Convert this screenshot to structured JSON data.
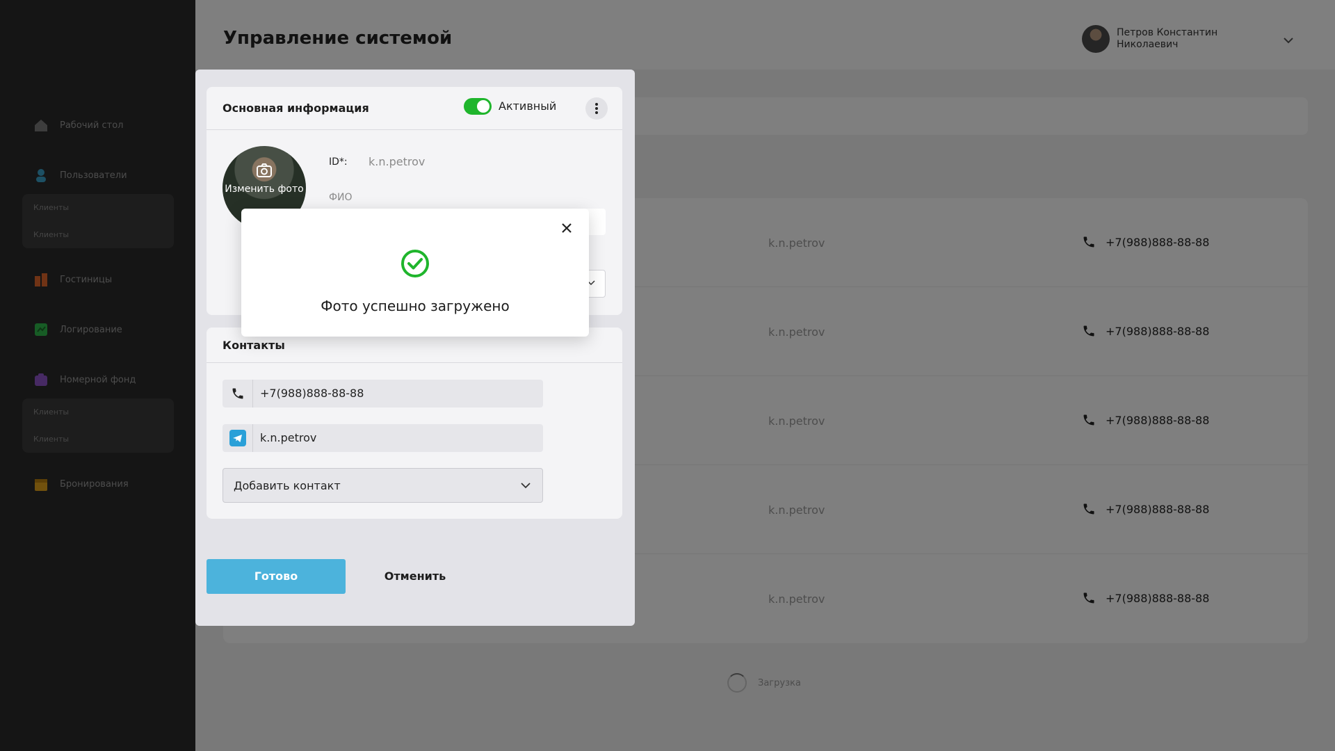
{
  "app": {
    "title": "Управление системой"
  },
  "user": {
    "name": "Петров Константин Николаевич"
  },
  "sidebar": {
    "items": [
      {
        "label": "Рабочий стол",
        "icon": "home-icon",
        "color": "#7a7a7a"
      },
      {
        "label": "Пользователи",
        "icon": "user-icon",
        "color": "#3aa0c8"
      },
      {
        "label": "Гостиницы",
        "icon": "hotel-icon",
        "color": "#e0662a"
      },
      {
        "label": "Логирование",
        "icon": "log-icon",
        "color": "#2fb84a"
      },
      {
        "label": "Номерной фонд",
        "icon": "room-fund-icon",
        "color": "#8e55c9"
      },
      {
        "label": "Бронирования",
        "icon": "calendar-icon",
        "color": "#e3a21a"
      }
    ],
    "users_sub": [
      "Клиенты",
      "Клиенты"
    ],
    "rooms_sub": [
      "Клиенты",
      "Клиенты"
    ]
  },
  "table": {
    "rows": [
      {
        "login": "k.n.petrov",
        "phone": "+7(988)888-88-88"
      },
      {
        "login": "k.n.petrov",
        "phone": "+7(988)888-88-88"
      },
      {
        "login": "k.n.petrov",
        "phone": "+7(988)888-88-88"
      },
      {
        "login": "k.n.petrov",
        "phone": "+7(988)888-88-88"
      },
      {
        "login": "k.n.petrov",
        "phone": "+7(988)888-88-88"
      }
    ],
    "loading_label": "Загрузка"
  },
  "dialog": {
    "basic": {
      "title": "Основная информация",
      "status_label": "Активный",
      "status_active": true,
      "change_photo_label": "Изменить фото",
      "id_label": "ID*:",
      "id_value": "k.n.petrov",
      "fio_label": "ФИО"
    },
    "contacts": {
      "title": "Контакты",
      "phone": "+7(988)888-88-88",
      "telegram": "k.n.petrov",
      "add_label": "Добавить контакт"
    },
    "done_label": "Готово",
    "cancel_label": "Отменить"
  },
  "toast": {
    "message": "Фото успешно загружено"
  },
  "colors": {
    "accent_button": "#4cb3dc",
    "toggle_on": "#1fb52c",
    "success_check": "#1fb52c",
    "telegram": "#2aa0d8"
  }
}
